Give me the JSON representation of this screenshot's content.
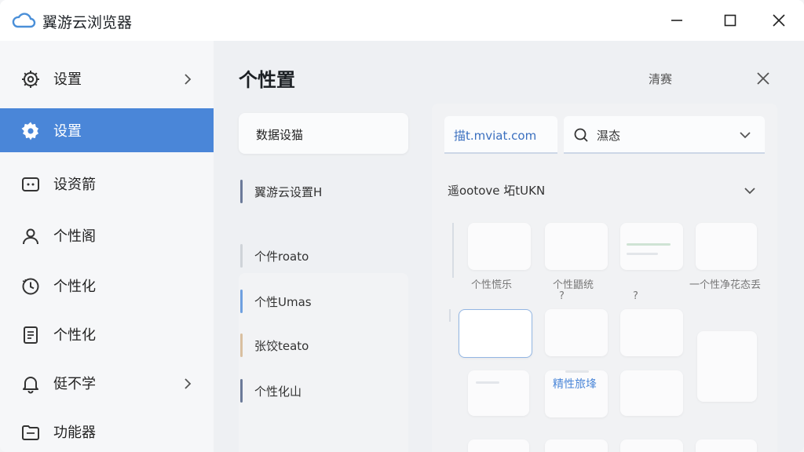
{
  "window": {
    "title": "翼游云浏览器",
    "controls": [
      "minimize",
      "maximize",
      "close"
    ]
  },
  "sidebar": {
    "items": [
      {
        "label": "设置",
        "icon": "gear-outline-icon",
        "has_chevron": true,
        "active": false
      },
      {
        "label": "设置",
        "icon": "gear-filled-icon",
        "has_chevron": false,
        "active": true
      },
      {
        "label": "设资箭",
        "icon": "dots-box-icon",
        "has_chevron": false,
        "active": false
      },
      {
        "label": "个性阁",
        "icon": "person-icon",
        "has_chevron": false,
        "active": false
      },
      {
        "label": "个性化",
        "icon": "clock-icon",
        "has_chevron": false,
        "active": false
      },
      {
        "label": "个性化",
        "icon": "document-icon",
        "has_chevron": false,
        "active": false
      },
      {
        "label": "侹不学",
        "icon": "bell-icon",
        "has_chevron": true,
        "active": false
      },
      {
        "label": "功能器",
        "icon": "folder-icon",
        "has_chevron": false,
        "active": false
      }
    ]
  },
  "main": {
    "title": "个性置",
    "clear_label": "清赛",
    "middle": {
      "card_label": "数据设猫",
      "items": [
        {
          "label": "翼游云设置H",
          "accent": "#6b7a99"
        },
        {
          "label": "个件roato",
          "accent": "#cfd3d8"
        },
        {
          "label": "个性Umas",
          "accent": "#6fa0e0"
        },
        {
          "label": "张饺teato",
          "accent": "#d9bfa0"
        },
        {
          "label": "个性化山",
          "accent": "#6b7a99"
        }
      ]
    },
    "right": {
      "url_value": "描t.mviat.com",
      "search_value": "濕态",
      "section_title": "遥ootove 坧tUKN",
      "tiles": [
        {
          "label": "个性慌乐"
        },
        {
          "label": "个性鼯统"
        },
        {
          "label": "?"
        },
        {
          "label": "一个性净花态丢"
        },
        {
          "label": ""
        },
        {
          "label": "精性旅埄"
        },
        {
          "label": ""
        },
        {
          "label": ""
        }
      ]
    }
  },
  "colors": {
    "accent": "#4a86d8",
    "link": "#3a6fbf",
    "selected_border": "#93b6e3"
  }
}
